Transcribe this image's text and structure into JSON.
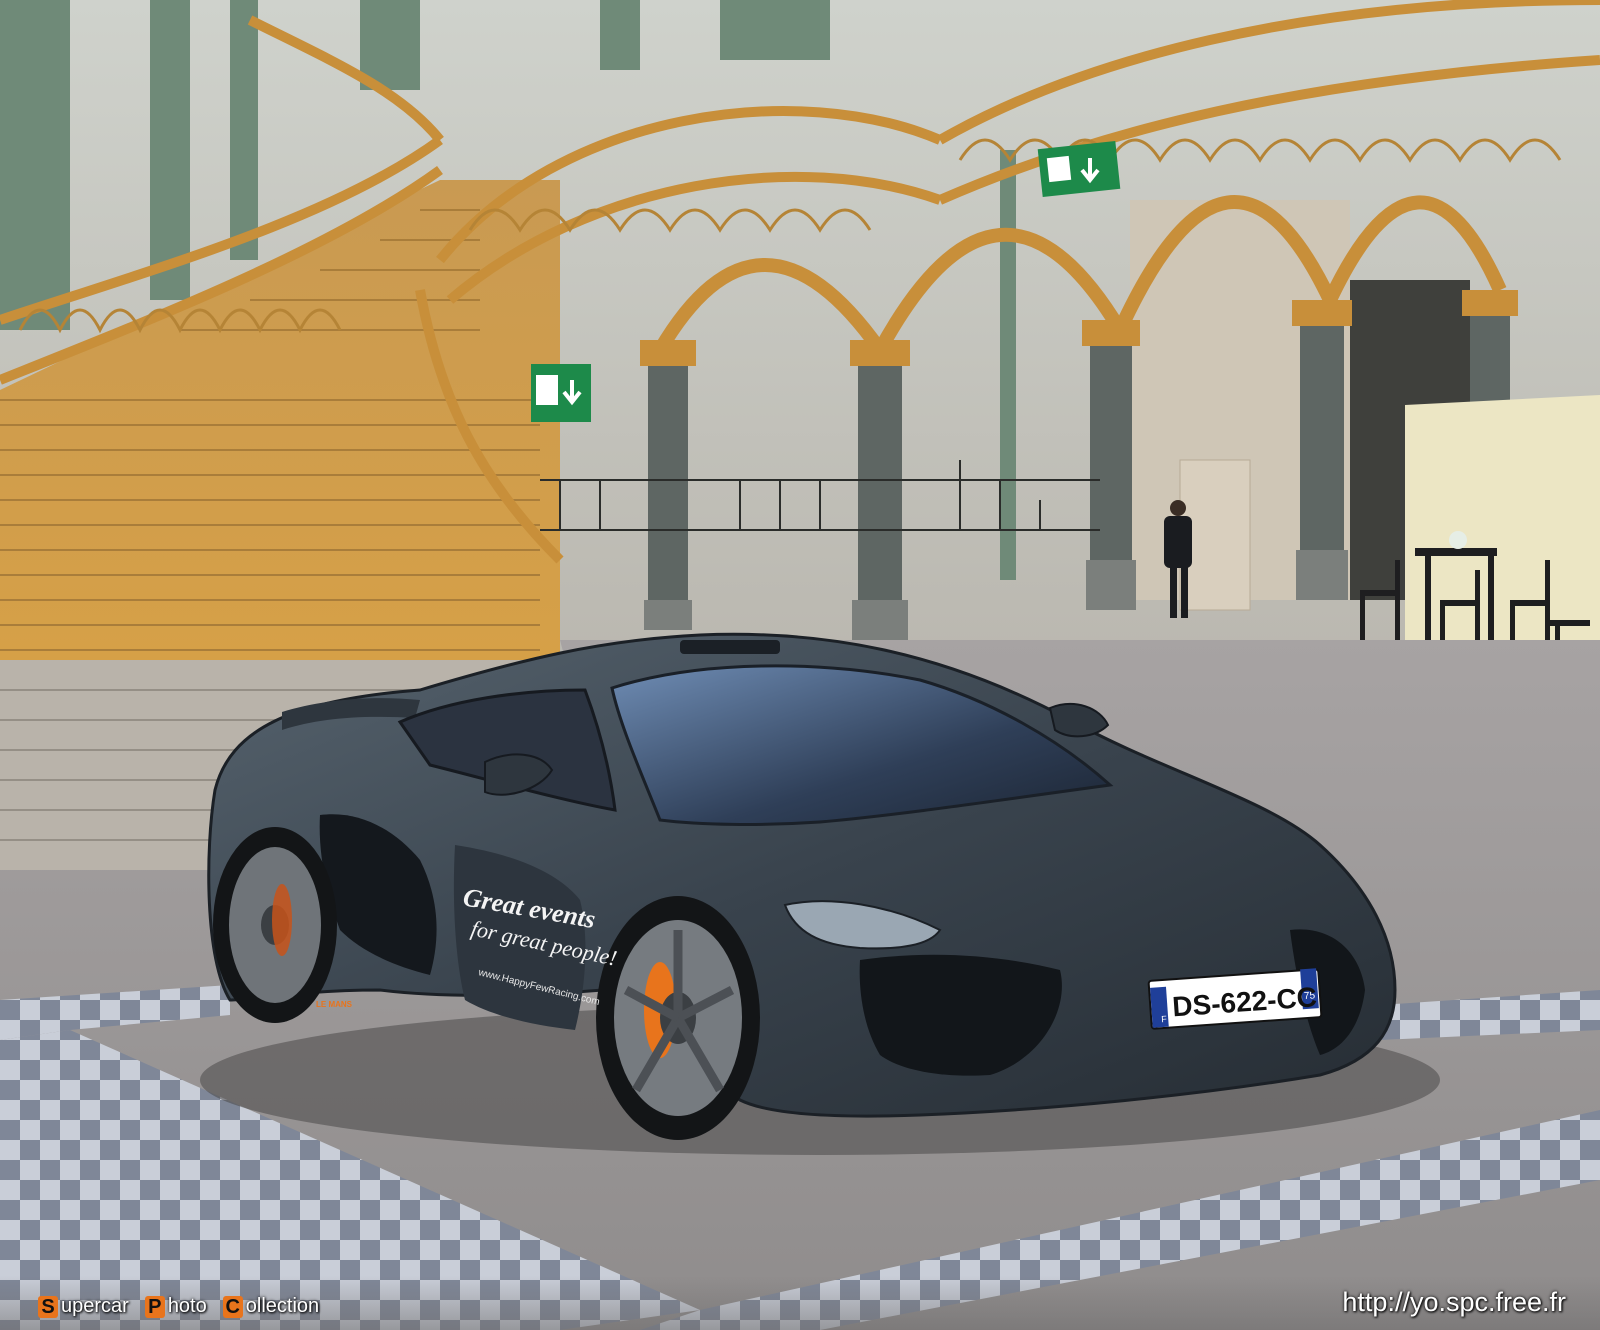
{
  "photo": {
    "plate": {
      "text": "DS-622-CC",
      "country": "F",
      "dept": "75"
    },
    "door_decal": {
      "line1": "Great events",
      "line2": "for great people!",
      "url": "www.HappyFewRacing.com"
    },
    "side_badge": "LE MANS"
  },
  "watermark": {
    "brand_initials": [
      "S",
      "P",
      "C"
    ],
    "brand_rest": [
      "upercar",
      "hoto",
      "ollection"
    ],
    "url": "http://yo.spc.free.fr"
  },
  "colors": {
    "stair_gold": "#d9a24a",
    "iron_green": "#6f8a78",
    "car_body": "#3b4650",
    "floor": "#9a9797",
    "accent_orange": "#e8741c"
  }
}
